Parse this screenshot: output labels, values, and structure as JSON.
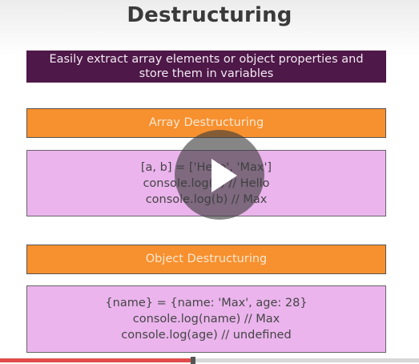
{
  "slide": {
    "title": "Destructuring",
    "banner_lines": [
      "Easily extract array elements or object properties and",
      "store them in variables"
    ],
    "sections": [
      {
        "header": "Array Destructuring",
        "code": [
          "[a, b] = ['Hello', 'Max']",
          "console.log(a) // Hello",
          "console.log(b) // Max"
        ]
      },
      {
        "header": "Object Destructuring",
        "code": [
          "{name} = {name: 'Max', age: 28}",
          "console.log(name) // Max",
          "console.log(age) // undefined"
        ]
      }
    ]
  },
  "player": {
    "play_icon": "play-icon",
    "progress_fraction": 0.46
  },
  "colors": {
    "banner": "#4e1848",
    "section_header": "#f7902e",
    "code_box": "#ebb4ed",
    "progress": "#e14b4b"
  }
}
